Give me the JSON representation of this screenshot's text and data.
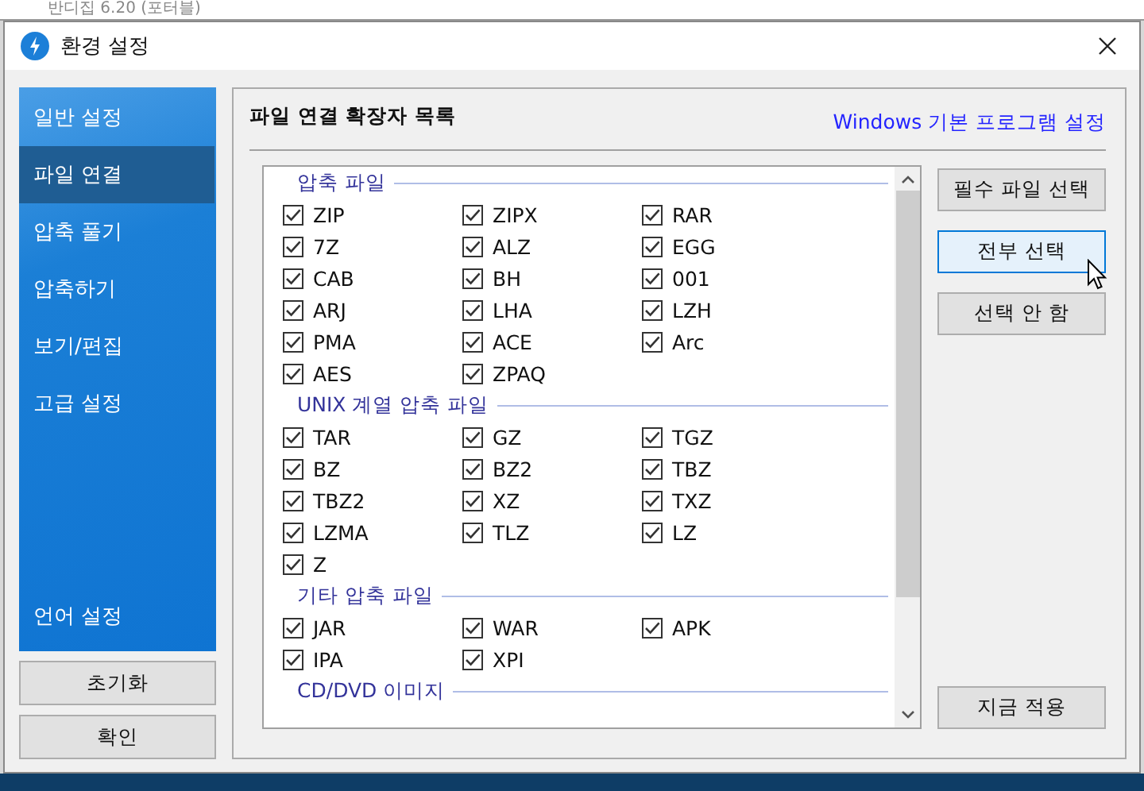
{
  "background_window": {
    "title": "반디집 6.20 (포터블)"
  },
  "dialog": {
    "title": "환경 설정"
  },
  "sidebar": {
    "items": [
      {
        "label": "일반 설정",
        "selected": false
      },
      {
        "label": "파일 연결",
        "selected": true
      },
      {
        "label": "압축 풀기",
        "selected": false
      },
      {
        "label": "압축하기",
        "selected": false
      },
      {
        "label": "보기/편집",
        "selected": false
      },
      {
        "label": "고급 설정",
        "selected": false
      }
    ],
    "bottom_item": "언어 설정"
  },
  "footer_buttons": [
    "초기화",
    "확인"
  ],
  "panel": {
    "heading": "파일 연결 확장자 목록",
    "link": "Windows 기본 프로그램 설정",
    "groups": [
      {
        "title": "압축 파일",
        "items": [
          {
            "label": "ZIP",
            "checked": true
          },
          {
            "label": "ZIPX",
            "checked": true
          },
          {
            "label": "RAR",
            "checked": true
          },
          {
            "label": "7Z",
            "checked": true
          },
          {
            "label": "ALZ",
            "checked": true
          },
          {
            "label": "EGG",
            "checked": true
          },
          {
            "label": "CAB",
            "checked": true
          },
          {
            "label": "BH",
            "checked": true
          },
          {
            "label": "001",
            "checked": true
          },
          {
            "label": "ARJ",
            "checked": true
          },
          {
            "label": "LHA",
            "checked": true
          },
          {
            "label": "LZH",
            "checked": true
          },
          {
            "label": "PMA",
            "checked": true
          },
          {
            "label": "ACE",
            "checked": true
          },
          {
            "label": "Arc",
            "checked": true
          },
          {
            "label": "AES",
            "checked": true
          },
          {
            "label": "ZPAQ",
            "checked": true
          }
        ]
      },
      {
        "title": "UNIX 계열 압축 파일",
        "items": [
          {
            "label": "TAR",
            "checked": true
          },
          {
            "label": "GZ",
            "checked": true
          },
          {
            "label": "TGZ",
            "checked": true
          },
          {
            "label": "BZ",
            "checked": true
          },
          {
            "label": "BZ2",
            "checked": true
          },
          {
            "label": "TBZ",
            "checked": true
          },
          {
            "label": "TBZ2",
            "checked": true
          },
          {
            "label": "XZ",
            "checked": true
          },
          {
            "label": "TXZ",
            "checked": true
          },
          {
            "label": "LZMA",
            "checked": true
          },
          {
            "label": "TLZ",
            "checked": true
          },
          {
            "label": "LZ",
            "checked": true
          },
          {
            "label": "Z",
            "checked": true
          }
        ]
      },
      {
        "title": "기타 압축 파일",
        "items": [
          {
            "label": "JAR",
            "checked": true
          },
          {
            "label": "WAR",
            "checked": true
          },
          {
            "label": "APK",
            "checked": true
          },
          {
            "label": "IPA",
            "checked": true
          },
          {
            "label": "XPI",
            "checked": true
          }
        ]
      },
      {
        "title": "CD/DVD 이미지"
      }
    ],
    "side_buttons": [
      {
        "label": "필수 파일 선택",
        "hovered": false
      },
      {
        "label": "전부 선택",
        "hovered": true
      },
      {
        "label": "선택 안 함",
        "hovered": false
      }
    ],
    "apply_button": "지금 적용"
  }
}
